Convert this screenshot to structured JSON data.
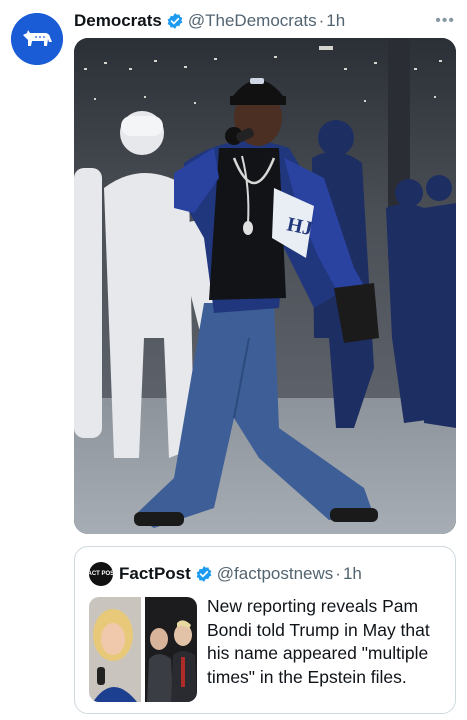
{
  "tweet": {
    "author_name": "Democrats",
    "handle": "@TheDemocrats",
    "separator": "·",
    "time": "1h",
    "more_label": "•••",
    "avatar_icon": "donkey-logo-icon",
    "brand_color": "#1a5bd6"
  },
  "quote": {
    "author_name": "FactPost",
    "handle": "@factpostnews",
    "separator": "·",
    "time": "1h",
    "avatar_text": "FACT POST",
    "text": "New reporting reveals Pam Bondi told Trump in May that his name appeared \"multiple times\" in the Epstein files."
  },
  "colors": {
    "verified": "#1d9bf0",
    "secondary_text": "#536471",
    "border": "#cfd9de"
  }
}
